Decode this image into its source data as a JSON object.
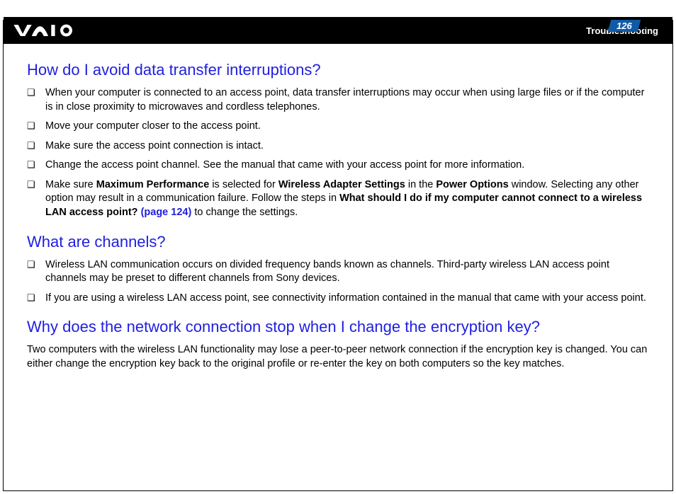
{
  "header": {
    "page_number": "126",
    "section": "Troubleshooting"
  },
  "sections": [
    {
      "heading": "How do I avoid data transfer interruptions?",
      "items": [
        {
          "text": "When your computer is connected to an access point, data transfer interruptions may occur when using large files or if the computer is in close proximity to microwaves and cordless telephones."
        },
        {
          "text": "Move your computer closer to the access point."
        },
        {
          "text": "Make sure the access point connection is intact."
        },
        {
          "text": "Change the access point channel. See the manual that came with your access point for more information."
        },
        {
          "pre": "Make sure ",
          "b1": "Maximum Performance",
          "mid1": " is selected for ",
          "b2": "Wireless Adapter Settings",
          "mid2": " in the ",
          "b3": "Power Options",
          "mid3": " window. Selecting any other option may result in a communication failure. Follow the steps in ",
          "b4": "What should I do if my computer cannot connect to a wireless LAN access point? ",
          "link": "(page 124)",
          "post": " to change the settings."
        }
      ]
    },
    {
      "heading": "What are channels?",
      "items": [
        {
          "text": "Wireless LAN communication occurs on divided frequency bands known as channels. Third-party wireless LAN access point channels may be preset to different channels from Sony devices."
        },
        {
          "text": "If you are using a wireless LAN access point, see connectivity information contained in the manual that came with your access point."
        }
      ]
    },
    {
      "heading": "Why does the network connection stop when I change the encryption key?",
      "para": "Two computers with the wireless LAN functionality may lose a peer-to-peer network connection if the encryption key is changed. You can either change the encryption key back to the original profile or re-enter the key on both computers so the key matches."
    }
  ]
}
